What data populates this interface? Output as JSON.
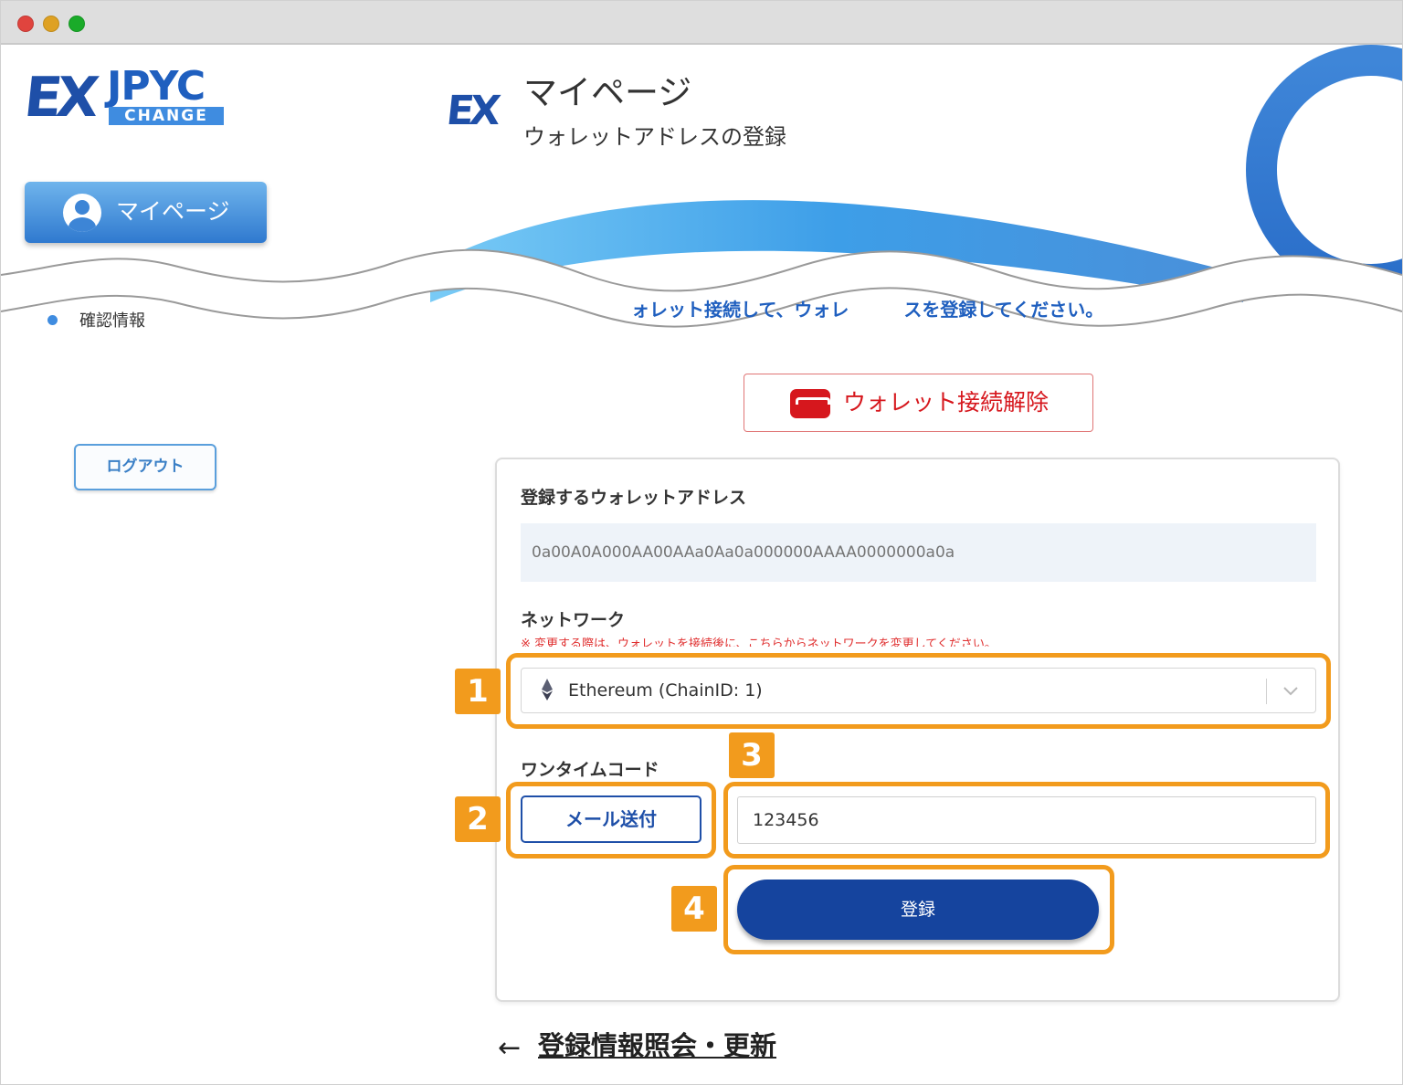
{
  "window": {
    "controls": [
      "close",
      "minimize",
      "zoom"
    ]
  },
  "brand": {
    "logo_ex": "EX",
    "logo_jpyc": "JPYC",
    "logo_change": "CHANGE",
    "accent": "#1e4fa8",
    "highlight": "#f29b1d",
    "danger": "#d6171d"
  },
  "sidebar": {
    "mypage_label": "マイページ",
    "mypage_icon": "user-avatar-icon",
    "items": [
      {
        "label": "確認情報"
      }
    ],
    "logout_label": "ログアウト"
  },
  "header": {
    "mark": "EX",
    "title": "マイページ",
    "subtitle": "ウォレットアドレスの登録"
  },
  "main": {
    "instruction": "ォレット接続して、ウォレ　　　スを登録してください。",
    "disconnect_label": "ウォレット接続解除",
    "disconnect_icon": "wallet-icon",
    "form": {
      "address_label": "登録するウォレットアドレス",
      "address_placeholder": "0a00A0A000AA00AAa0Aa0a000000AAAA0000000a0a",
      "network_label": "ネットワーク",
      "network_warning": "※ 変更する際は、ウォレットを接続後に、こちらからネットワークを変更してください。",
      "network_value": "Ethereum (ChainID: 1)",
      "network_icon": "ethereum-icon",
      "otp_label": "ワンタイムコード",
      "mail_button": "メール送付",
      "otp_value": "123456",
      "register_button": "登録"
    },
    "back_link": "登録情報照会・更新"
  },
  "annotations": [
    {
      "number": "1",
      "target": "network-select"
    },
    {
      "number": "2",
      "target": "mail-button"
    },
    {
      "number": "3",
      "target": "otp-input"
    },
    {
      "number": "4",
      "target": "register-button"
    }
  ]
}
